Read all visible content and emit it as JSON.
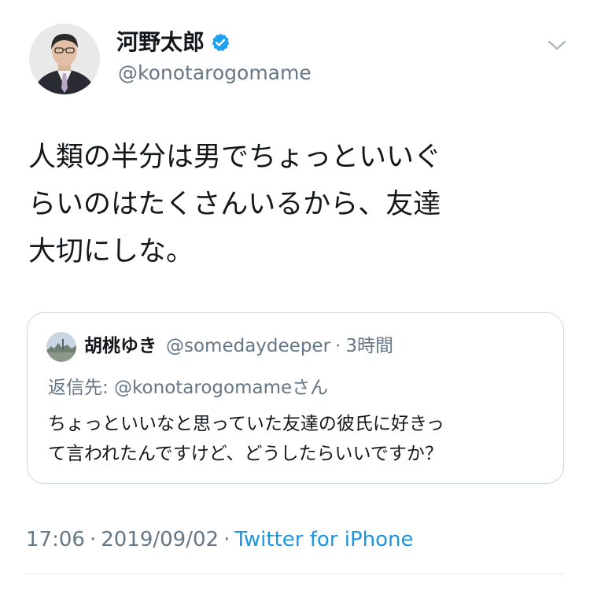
{
  "author": {
    "display_name": "河野太郎",
    "handle": "@konotarogomame",
    "verified": true
  },
  "icons": {
    "verified": "verified-badge-icon",
    "menu": "chevron-down-icon"
  },
  "tweet": {
    "lines": [
      "人類の半分は男でちょっといいぐ",
      "らいのはたくさんいるから、友達",
      "大切にしな。"
    ]
  },
  "quoted_tweet": {
    "display_name": "胡桃ゆき",
    "handle": "@somedaydeeper",
    "separator": "·",
    "time": "3時間",
    "reply_to": "返信先: @konotarogomameさん",
    "lines": [
      "ちょっといいなと思っていた友達の彼氏に好きっ",
      "て言われたんですけど、どうしたらいいですか？"
    ]
  },
  "meta": {
    "time": "17:06",
    "separator1": "·",
    "date": "2019/09/02",
    "separator2": "·",
    "source": "Twitter for iPhone"
  },
  "colors": {
    "text": "#14171a",
    "secondary": "#657786",
    "link": "#1b95e0",
    "verified": "#1da1f2",
    "border": "#ccd6dd"
  }
}
